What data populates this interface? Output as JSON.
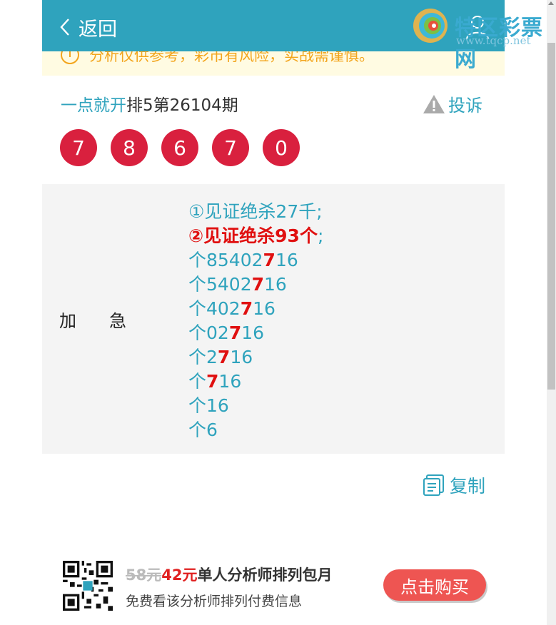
{
  "header": {
    "back_label": "返回",
    "site_name": "特区彩票网",
    "site_url": "www.tqcp.net"
  },
  "notice": {
    "text": "分析仅供参考，彩市有风险，实战需谨慎。"
  },
  "issue": {
    "source": "一点就开",
    "title": "排5第26104期",
    "complain_label": "投诉"
  },
  "balls": [
    "7",
    "8",
    "6",
    "7",
    "0"
  ],
  "content": {
    "label": "加急",
    "line1": "①见证绝杀27千;",
    "line2_main": "②见证绝杀93个",
    "line2_end": ";",
    "lines": [
      {
        "pre": "个85402",
        "hl": "7",
        "post": "16"
      },
      {
        "pre": "个5402",
        "hl": "7",
        "post": "16"
      },
      {
        "pre": "个402",
        "hl": "7",
        "post": "16"
      },
      {
        "pre": "个02",
        "hl": "7",
        "post": "16"
      },
      {
        "pre": "个2",
        "hl": "7",
        "post": "16"
      },
      {
        "pre": "个",
        "hl": "7",
        "post": "16"
      },
      {
        "pre": "个16",
        "hl": "",
        "post": ""
      },
      {
        "pre": "个6",
        "hl": "",
        "post": ""
      }
    ]
  },
  "copy_label": "复制",
  "promo": {
    "old_price": "58元",
    "new_price": "42元",
    "title": "单人分析师排列包月",
    "subtitle": "免费看该分析师排列付费信息",
    "buy_label": "点击购买"
  },
  "colors": {
    "header": "#2fa3bd",
    "ball": "#d9203e",
    "highlight": "#e01010",
    "buy": "#ee5552"
  }
}
